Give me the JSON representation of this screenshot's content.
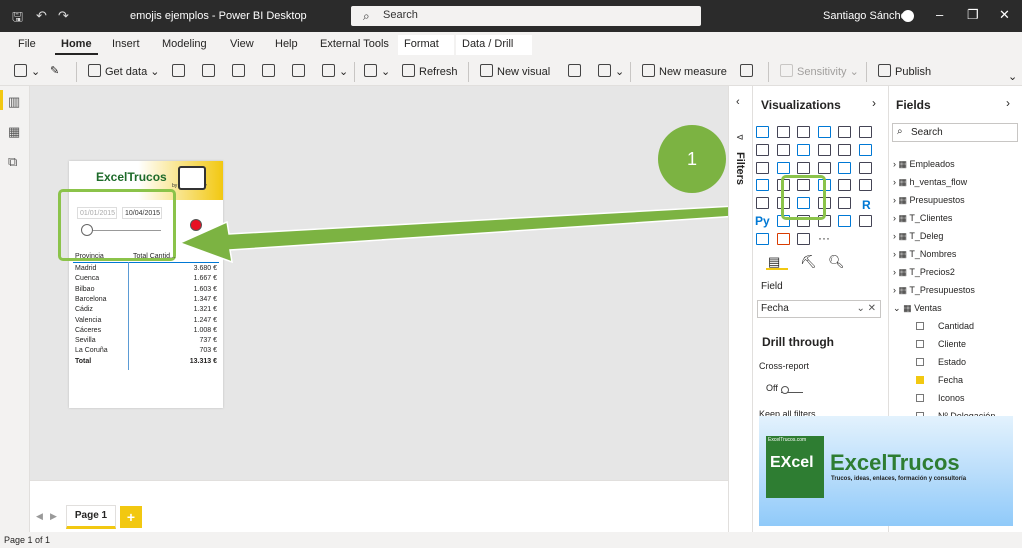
{
  "titlebar": {
    "title": "emojis ejemplos - Power BI Desktop",
    "search": "Search",
    "user": "Santiago Sánchez"
  },
  "tabs": [
    "File",
    "Home",
    "Insert",
    "Modeling",
    "View",
    "Help",
    "External Tools",
    "Format",
    "Data / Drill"
  ],
  "ribbon": {
    "get_data": "Get data",
    "refresh": "Refresh",
    "new_visual": "New visual",
    "new_measure": "New measure",
    "sensitivity": "Sensitivity",
    "publish": "Publish"
  },
  "logo": {
    "title": "ExcelTrucos",
    "sub": "by hernaldelsky"
  },
  "slicer": {
    "start": "01/01/2015",
    "end": "10/04/2015"
  },
  "table": {
    "headers": [
      "Provincia",
      "Total Cantid..."
    ],
    "rows": [
      [
        "Madrid",
        "3.680 €"
      ],
      [
        "Cuenca",
        "1.667 €"
      ],
      [
        "Bilbao",
        "1.603 €"
      ],
      [
        "Barcelona",
        "1.347 €"
      ],
      [
        "Cádiz",
        "1.321 €"
      ],
      [
        "Valencia",
        "1.247 €"
      ],
      [
        "Cáceres",
        "1.008 €"
      ],
      [
        "Sevilla",
        "737 €"
      ],
      [
        "La Coruña",
        "703 €"
      ]
    ],
    "total": [
      "Total",
      "13.313 €"
    ]
  },
  "callout": "1",
  "pages": {
    "tab": "Page 1",
    "status": "Page 1 of 1"
  },
  "filters": {
    "label": "Filters"
  },
  "viz": {
    "title": "Visualizations",
    "field_label": "Field",
    "field_value": "Fecha",
    "drill": "Drill through",
    "cross": "Cross-report",
    "off": "Off",
    "keep": "Keep all filters",
    "py": "Py",
    "r": "R"
  },
  "fields": {
    "title": "Fields",
    "search": "Search",
    "tables": [
      "Empleados",
      "h_ventas_flow",
      "Presupuestos",
      "T_Clientes",
      "T_Deleg",
      "T_Nombres",
      "T_Precios2",
      "T_Presupuestos",
      "Ventas"
    ],
    "ventas_fields": [
      "Cantidad",
      "Cliente",
      "Estado",
      "Fecha",
      "Iconos",
      "Nº Delegación"
    ]
  },
  "banner": {
    "left": "EXcel",
    "tiny": "ExcelTrucos.com",
    "title": "ExcelTrucos",
    "sub": "Trucos, ideas, enlaces, formación y consultoría"
  },
  "colors": {
    "accent": "#f2c811",
    "highlight": "#8bc34a",
    "green": "#2e7d32"
  }
}
